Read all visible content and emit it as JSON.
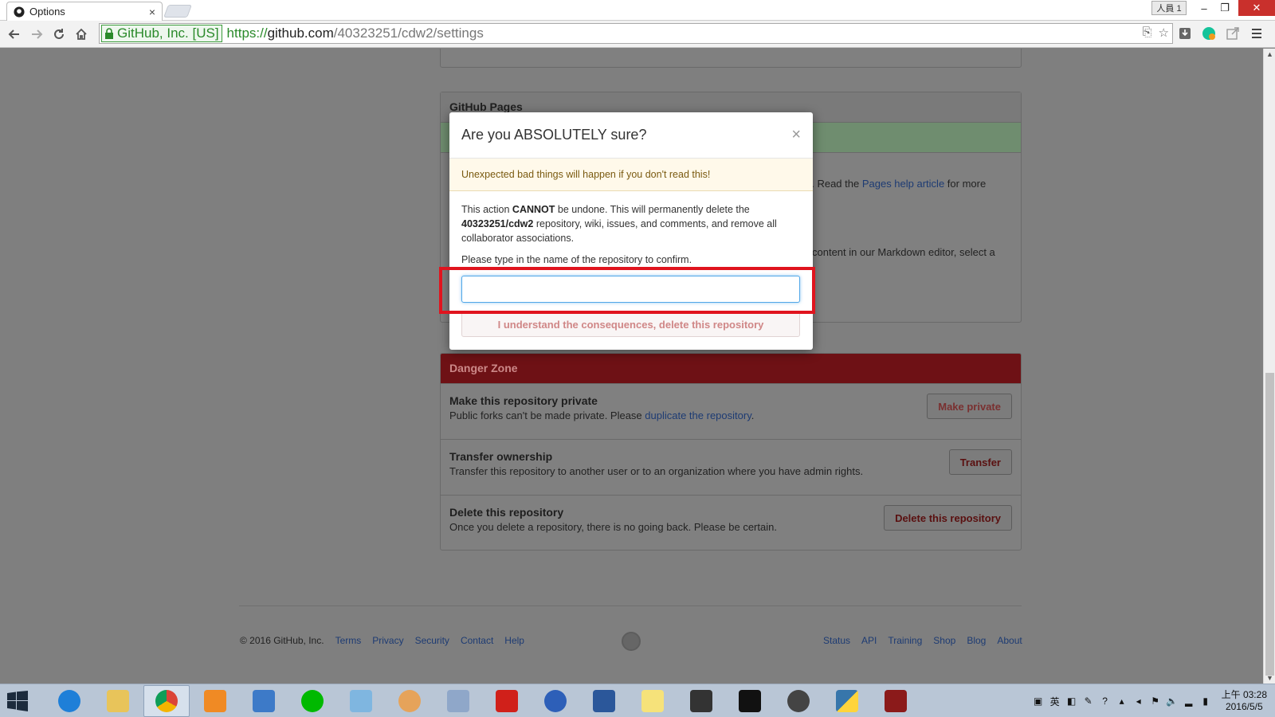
{
  "browser": {
    "tab_title": "Options",
    "tab_close": "×",
    "profile": "人員 1",
    "win_minimize": "–",
    "win_restore": "❐",
    "win_close": "✕",
    "ev_label": "GitHub, Inc. [US]",
    "url_scheme": "https://",
    "url_host": "github.com",
    "url_path": "/40323251/cdw2/settings"
  },
  "page": {
    "pages_header": "GitHub Pages",
    "pages_text1_pre": "n. Read the ",
    "pages_text1_link": "Pages help article",
    "pages_text1_post": " for more",
    "pages_text2": "content in our Markdown editor, select a",
    "danger_header": "Danger Zone",
    "danger_rows": [
      {
        "title": "Make this repository private",
        "desc_pre": "Public forks can't be made private. Please ",
        "desc_link": "duplicate the repository",
        "desc_post": ".",
        "button": "Make private"
      },
      {
        "title": "Transfer ownership",
        "desc_pre": "Transfer this repository to another user or to an organization where you have admin rights.",
        "desc_link": "",
        "desc_post": "",
        "button": "Transfer"
      },
      {
        "title": "Delete this repository",
        "desc_pre": "Once you delete a repository, there is no going back. Please be certain.",
        "desc_link": "",
        "desc_post": "",
        "button": "Delete this repository"
      }
    ]
  },
  "footer": {
    "copyright": "© 2016 GitHub, Inc.",
    "left_links": [
      "Terms",
      "Privacy",
      "Security",
      "Contact",
      "Help"
    ],
    "right_links": [
      "Status",
      "API",
      "Training",
      "Shop",
      "Blog",
      "About"
    ]
  },
  "modal": {
    "title": "Are you ABSOLUTELY sure?",
    "close": "×",
    "warning": "Unexpected bad things will happen if you don't read this!",
    "body_1": "This action ",
    "body_cannot": "CANNOT",
    "body_2": " be undone. This will permanently delete the ",
    "body_repo": "40323251/cdw2",
    "body_3": " repository, wiki, issues, and comments, and remove all collaborator associations.",
    "prompt": "Please type in the name of the repository to confirm.",
    "input_value": "",
    "confirm_button": "I understand the consequences, delete this repository"
  },
  "taskbar": {
    "apps": [
      "start",
      "internet-explorer",
      "file-explorer",
      "chrome",
      "media-player",
      "bird-app",
      "line",
      "notepad-app",
      "paint-app",
      "calculator",
      "acrobat",
      "moon-app",
      "word",
      "sticky-notes",
      "clapper-app",
      "cmd",
      "sphere-app",
      "python",
      "game-app"
    ],
    "ime": "英",
    "clock_time": "上午 03:28",
    "clock_date": "2016/5/5"
  },
  "colors": {
    "danger_red": "#6e1115",
    "highlight_red": "#e0141e",
    "warn_bg": "#fff9ea",
    "link_blue": "#4078c0"
  }
}
